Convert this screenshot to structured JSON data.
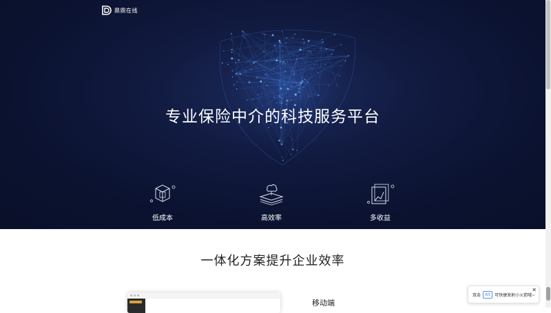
{
  "brand": {
    "name": "鼎鼎在线",
    "icon": "dd-logo-icon"
  },
  "hero": {
    "title": "专业保险中介的科技服务平台",
    "illustration": "network-shield-graphic",
    "features": [
      {
        "label": "低成本",
        "icon": "box-icon"
      },
      {
        "label": "高效率",
        "icon": "cloud-layers-icon"
      },
      {
        "label": "多收益",
        "icon": "chart-frame-icon"
      }
    ]
  },
  "solutions": {
    "title": "一体化方案提升企业效率",
    "mobile_label": "移动端"
  },
  "popup": {
    "prefix": "双击",
    "key": "Alt",
    "message": "可快捷发射小火箭哦~",
    "close": "✕"
  },
  "colors": {
    "hero_bg": "#0b1230",
    "accent": "#4aa8ff",
    "text_dark": "#222222"
  }
}
